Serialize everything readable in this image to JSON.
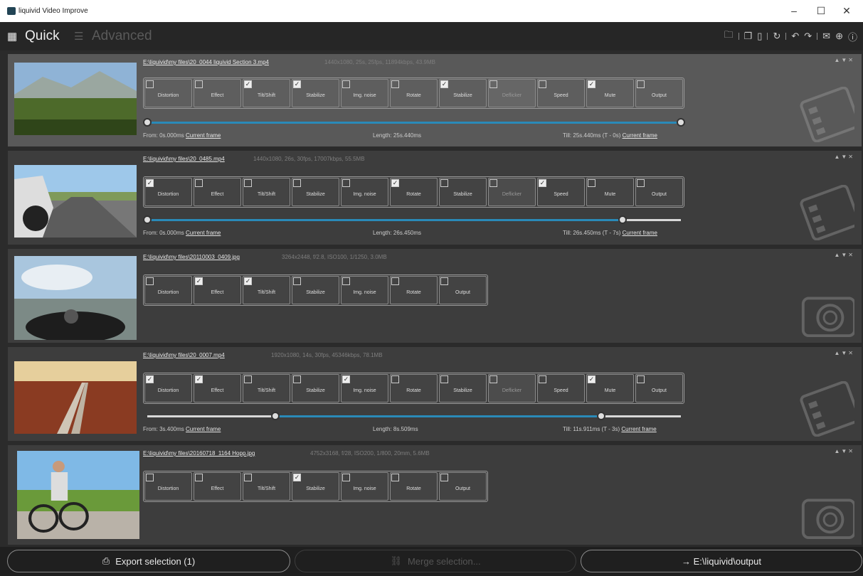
{
  "window": {
    "title": "liquivid Video Improve",
    "minimize": "–",
    "maximize": "☐",
    "close": "✕"
  },
  "toolbar": {
    "quick_label": "Quick",
    "advanced_label": "Advanced",
    "quick_icon": "grid-icon",
    "advanced_icon": "list-icon",
    "icons": [
      "folder-open-icon",
      "copy-icon",
      "paste-icon",
      "reset-icon",
      "undo-icon",
      "redo-icon",
      "mail-icon",
      "globe-icon",
      "info-icon"
    ]
  },
  "clips": [
    {
      "path": "E:\\liquivid\\my files\\20_0044 liquivid Section 3.mp4",
      "info": "1440x1080, 25s, 25fps, 11894kbps, 43.9MB",
      "selected": true,
      "tools": [
        {
          "label": "Distortion",
          "checked": false
        },
        {
          "label": "Effect",
          "checked": false
        },
        {
          "label": "Tilt/Shift",
          "checked": true
        },
        {
          "label": "Stabilize",
          "checked": true
        },
        {
          "label": "Img. noise",
          "checked": false
        },
        {
          "label": "Rotate",
          "checked": false
        },
        {
          "label": "Stabilize",
          "checked": true
        },
        {
          "label": "Deflicker",
          "checked": false,
          "dim": true
        },
        {
          "label": "Speed",
          "checked": false
        },
        {
          "label": "Mute",
          "checked": true
        },
        {
          "label": "Output",
          "checked": false
        }
      ],
      "trim": {
        "from_label": "From: 0s.000ms",
        "length_label": "Length: 25s.440ms",
        "till_label": "Till: 25s.440ms (T - 0s)",
        "current_frame": "Current frame",
        "start": 0,
        "end": 1.0
      }
    },
    {
      "path": "E:\\liquivid\\my files\\20_0485.mp4",
      "info": "1440x1080, 26s, 30fps, 17007kbps, 55.5MB",
      "selected": false,
      "tools": [
        {
          "label": "Distortion",
          "checked": true
        },
        {
          "label": "Effect",
          "checked": false
        },
        {
          "label": "Tilt/Shift",
          "checked": false
        },
        {
          "label": "Stabilize",
          "checked": false
        },
        {
          "label": "Img. noise",
          "checked": false
        },
        {
          "label": "Rotate",
          "checked": true
        },
        {
          "label": "Stabilize",
          "checked": false
        },
        {
          "label": "Deflicker",
          "checked": false,
          "dim": true
        },
        {
          "label": "Speed",
          "checked": true
        },
        {
          "label": "Mute",
          "checked": false
        },
        {
          "label": "Output",
          "checked": false
        }
      ],
      "trim": {
        "from_label": "From: 0s.000ms",
        "length_label": "Length: 26s.450ms",
        "till_label": "Till: 26s.450ms (T - 7s)",
        "current_frame": "Current frame",
        "start": 0,
        "end": 0.89
      }
    },
    {
      "path": "E:\\liquivid\\my files\\20110003_0409.jpg",
      "info": "3264x2448, f/2.8, ISO100, 1/1250, 3.0MB",
      "selected": false,
      "tools": [
        {
          "label": "Distortion",
          "checked": false
        },
        {
          "label": "Effect",
          "checked": true
        },
        {
          "label": "Tilt/Shift",
          "checked": true
        },
        {
          "label": "Stabilize",
          "checked": false
        },
        {
          "label": "Img. noise",
          "checked": false
        },
        {
          "label": "Rotate",
          "checked": false
        },
        {
          "label": "Output",
          "checked": false
        }
      ]
    },
    {
      "path": "E:\\liquivid\\my files\\20_0007.mp4",
      "info": "1920x1080, 14s, 30fps, 45346kbps, 78.1MB",
      "selected": false,
      "tools": [
        {
          "label": "Distortion",
          "checked": true
        },
        {
          "label": "Effect",
          "checked": true
        },
        {
          "label": "Tilt/Shift",
          "checked": false
        },
        {
          "label": "Stabilize",
          "checked": false
        },
        {
          "label": "Img. noise",
          "checked": true
        },
        {
          "label": "Rotate",
          "checked": false
        },
        {
          "label": "Stabilize",
          "checked": false
        },
        {
          "label": "Deflicker",
          "checked": false,
          "dim": true
        },
        {
          "label": "Speed",
          "checked": false
        },
        {
          "label": "Mute",
          "checked": true
        },
        {
          "label": "Output",
          "checked": false
        }
      ],
      "trim": {
        "from_label": "From: 3s.400ms",
        "length_label": "Length: 8s.509ms",
        "till_label": "Till: 11s.911ms (T - 3s)",
        "current_frame": "Current frame",
        "start": 0.24,
        "end": 0.85
      }
    },
    {
      "path": "E:\\liquivid\\my files\\20160718_1164 Hopp.jpg",
      "info": "4752x3168, f/28, ISO200, 1/800, 20mm, 5.6MB",
      "selected": false,
      "tools": [
        {
          "label": "Distortion",
          "checked": false
        },
        {
          "label": "Effect",
          "checked": false
        },
        {
          "label": "Tilt/Shift",
          "checked": false
        },
        {
          "label": "Stabilize",
          "checked": true
        },
        {
          "label": "Img. noise",
          "checked": false
        },
        {
          "label": "Rotate",
          "checked": false
        },
        {
          "label": "Output",
          "checked": false
        }
      ]
    }
  ],
  "bottom": {
    "export_label": "Export selection (1)",
    "export_icon": "export-icon",
    "merge_label": "Merge selection...",
    "merge_icon": "link-icon",
    "output_label": "→ E:\\liquivid\\output"
  },
  "colors": {
    "accent": "#2a8ab8",
    "selected_row": "#595959",
    "row": "#3d3d3d"
  }
}
